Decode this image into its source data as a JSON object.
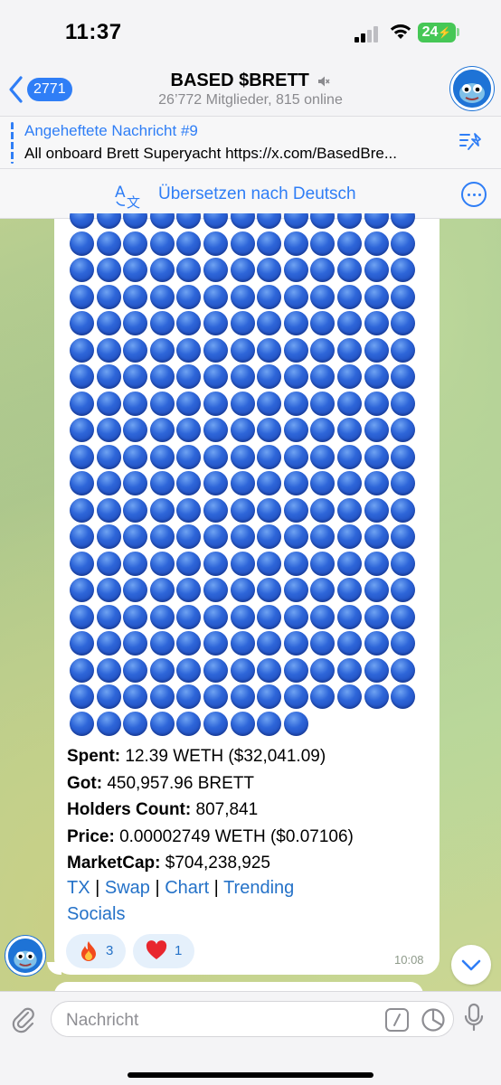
{
  "status": {
    "time": "11:37",
    "battery": "24"
  },
  "header": {
    "back_count": "2771",
    "title": "BASED $BRETT",
    "subtitle": "26’772 Mitglieder, 815 online"
  },
  "pinned": {
    "title": "Angeheftete Nachricht #9",
    "text": "All onboard Brett Superyacht https://x.com/BasedBre..."
  },
  "translate": {
    "label": "Übersetzen nach Deutsch"
  },
  "message": {
    "circle_rows_full": 19,
    "circles_per_row": 13,
    "last_row_count": 9,
    "spent_label": "Spent:",
    "spent_value": " 12.39 WETH ($32,041.09)",
    "got_label": "Got:",
    "got_value": " 450,957.96 BRETT",
    "holders_label": "Holders Count:",
    "holders_value": " 807,841",
    "price_label": "Price:",
    "price_value": " 0.00002749 WETH ($0.07106)",
    "marketcap_label": "MarketCap:",
    "marketcap_value": " $704,238,925",
    "links": {
      "tx": "TX",
      "swap": "Swap",
      "chart": "Chart",
      "trending": "Trending",
      "socials": "Socials",
      "separator": " | "
    },
    "reactions": [
      {
        "icon": "fire-emoji",
        "count": "3"
      },
      {
        "icon": "heart-emoji",
        "count": "1"
      }
    ],
    "time": "10:08"
  },
  "input": {
    "placeholder": "Nachricht"
  },
  "colors": {
    "accent": "#2f7ef6",
    "link": "#2572c8",
    "reaction_bg": "#e5f0fb",
    "circle_blue": "#2e66d9"
  }
}
